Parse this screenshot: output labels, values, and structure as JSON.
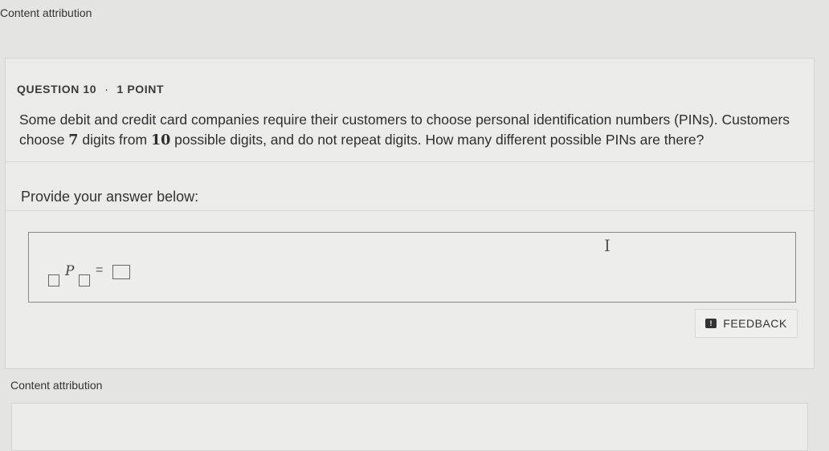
{
  "attribution_top": "Content attribution",
  "question": {
    "header_number": "QUESTION 10",
    "header_separator": "·",
    "header_points": "1 POINT",
    "text_part1": "Some debit and credit card companies require their customers to choose personal identification numbers (PINs). Customers choose ",
    "num1": "7",
    "text_part2": " digits from ",
    "num2": "10",
    "text_part3": " possible digits, and do not repeat digits. How many different possible PINs are there?"
  },
  "answer": {
    "prompt": "Provide your answer below:",
    "permutation_symbol": "P",
    "equals": "=",
    "cursor_glyph": "I"
  },
  "feedback": {
    "icon": "!",
    "label": "FEEDBACK"
  },
  "attribution_bottom": "Content attribution"
}
